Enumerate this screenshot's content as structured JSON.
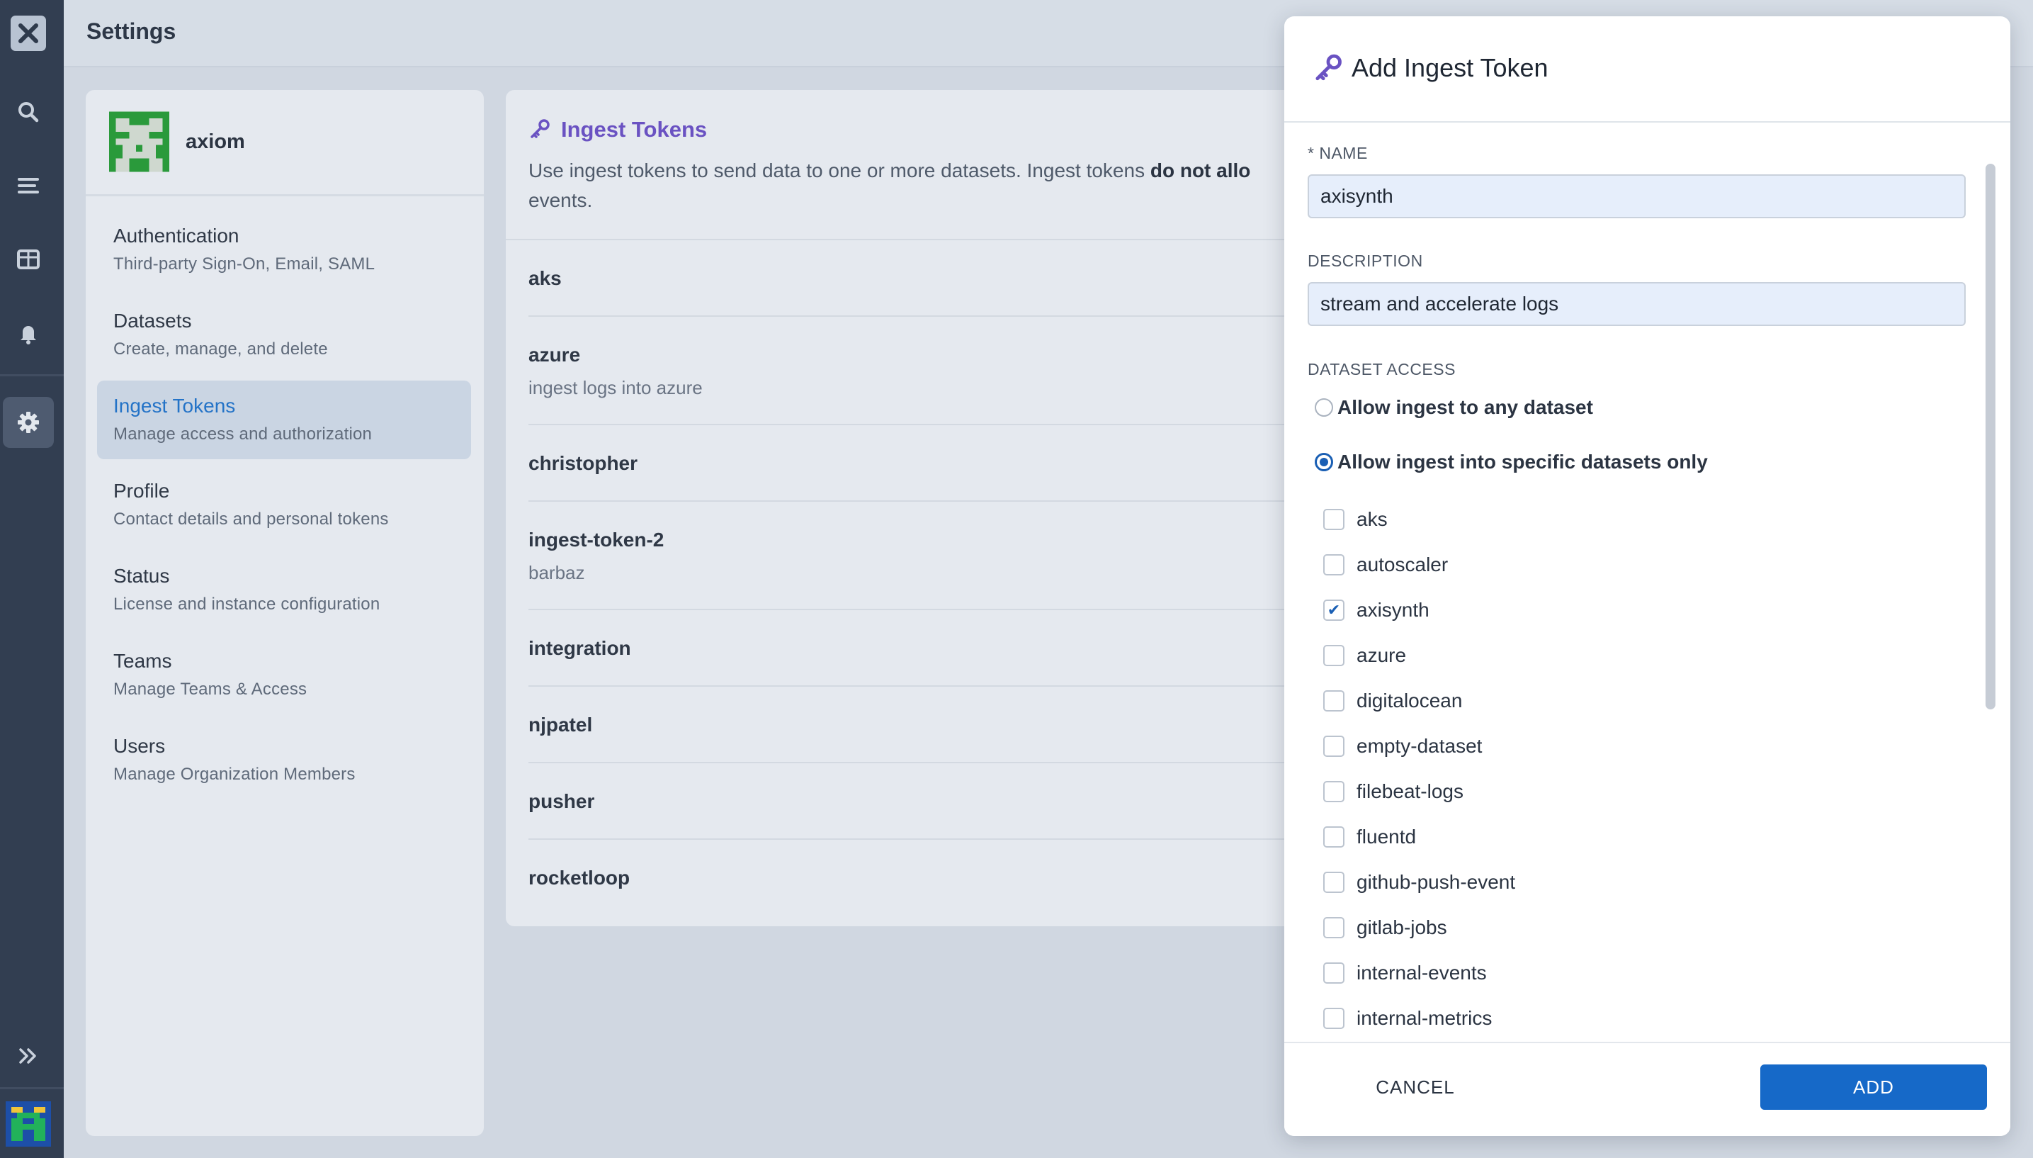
{
  "app": {
    "title": "Settings",
    "brand_colors": {
      "rail": "#323e51",
      "accent": "#1669c8",
      "purple": "#6a52c2"
    }
  },
  "rail": {
    "items": [
      {
        "icon": "close-logo-icon"
      },
      {
        "icon": "search-icon"
      },
      {
        "icon": "stream-icon"
      },
      {
        "icon": "dashboards-icon"
      },
      {
        "icon": "bell-icon"
      },
      {
        "icon": "gear-icon",
        "active": true
      },
      {
        "icon": "expand-icon"
      }
    ]
  },
  "org": {
    "name": "axiom"
  },
  "nav": {
    "items": [
      {
        "title": "Authentication",
        "subtitle": "Third-party Sign-On, Email, SAML"
      },
      {
        "title": "Datasets",
        "subtitle": "Create, manage, and delete"
      },
      {
        "title": "Ingest Tokens",
        "subtitle": "Manage access and authorization",
        "active": true
      },
      {
        "title": "Profile",
        "subtitle": "Contact details and personal tokens"
      },
      {
        "title": "Status",
        "subtitle": "License and instance configuration"
      },
      {
        "title": "Teams",
        "subtitle": "Manage Teams & Access"
      },
      {
        "title": "Users",
        "subtitle": "Manage Organization Members"
      }
    ]
  },
  "main": {
    "title": "Ingest Tokens",
    "description_start": "Use ingest tokens to send data to one or more datasets. Ingest tokens ",
    "description_bold": "do not allo",
    "description_end": "events.",
    "tokens": [
      {
        "name": "aks",
        "description": ""
      },
      {
        "name": "azure",
        "description": "ingest logs into azure"
      },
      {
        "name": "christopher",
        "description": ""
      },
      {
        "name": "ingest-token-2",
        "description": "barbaz"
      },
      {
        "name": "integration",
        "description": ""
      },
      {
        "name": "njpatel",
        "description": ""
      },
      {
        "name": "pusher",
        "description": ""
      },
      {
        "name": "rocketloop",
        "description": ""
      }
    ]
  },
  "modal": {
    "title": "Add Ingest Token",
    "name_label": "* NAME",
    "name_value": "axisynth",
    "description_label": "DESCRIPTION",
    "description_value": "stream and accelerate logs",
    "access_label": "DATASET ACCESS",
    "radio_any": "Allow ingest to any dataset",
    "radio_specific": "Allow ingest into specific datasets only",
    "selected_radio": "specific",
    "datasets": [
      {
        "name": "aks",
        "checked": false
      },
      {
        "name": "autoscaler",
        "checked": false
      },
      {
        "name": "axisynth",
        "checked": true
      },
      {
        "name": "azure",
        "checked": false
      },
      {
        "name": "digitalocean",
        "checked": false
      },
      {
        "name": "empty-dataset",
        "checked": false
      },
      {
        "name": "filebeat-logs",
        "checked": false
      },
      {
        "name": "fluentd",
        "checked": false
      },
      {
        "name": "github-push-event",
        "checked": false
      },
      {
        "name": "gitlab-jobs",
        "checked": false
      },
      {
        "name": "internal-events",
        "checked": false
      },
      {
        "name": "internal-metrics",
        "checked": false
      }
    ],
    "cancel_label": "CANCEL",
    "add_label": "ADD"
  }
}
